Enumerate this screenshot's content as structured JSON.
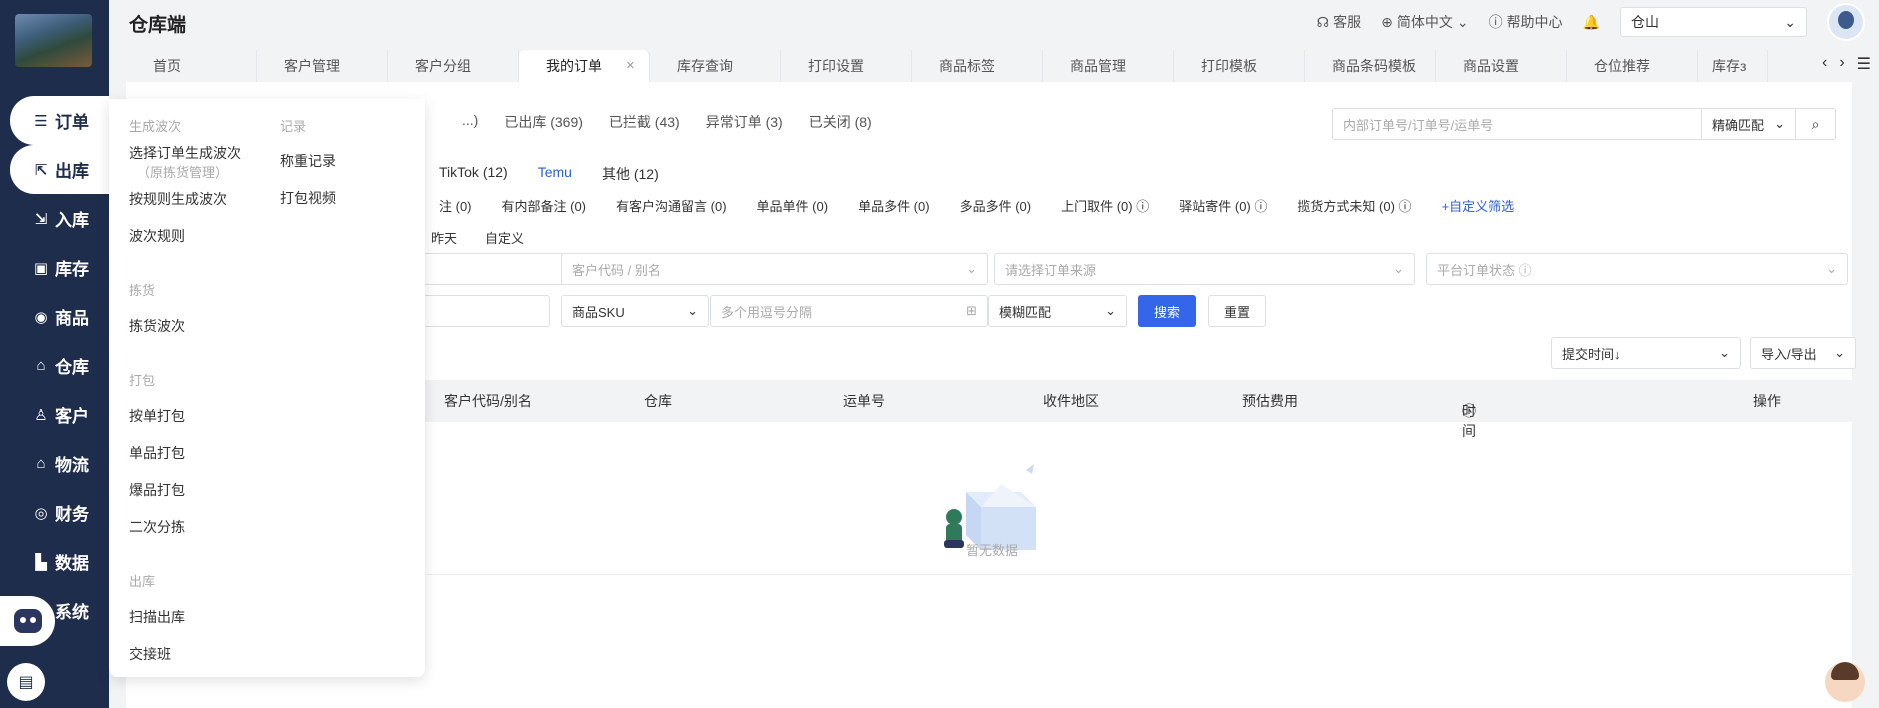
{
  "app": {
    "title": "仓库端"
  },
  "topbar": {
    "service": "客服",
    "language": "简体中文",
    "help": "帮助中心",
    "warehouse": "仓山"
  },
  "sidebar": {
    "items": [
      {
        "label": "订单",
        "icon": "list-icon"
      },
      {
        "label": "出库",
        "icon": "export-icon"
      },
      {
        "label": "入库",
        "icon": "import-icon"
      },
      {
        "label": "库存",
        "icon": "box-icon"
      },
      {
        "label": "商品",
        "icon": "bag-icon"
      },
      {
        "label": "仓库",
        "icon": "house-icon"
      },
      {
        "label": "客户",
        "icon": "user-icon"
      },
      {
        "label": "物流",
        "icon": "truck-icon"
      },
      {
        "label": "财务",
        "icon": "money-icon"
      },
      {
        "label": "数据",
        "icon": "chart-icon"
      },
      {
        "label": "系统",
        "icon": "robot-icon"
      }
    ]
  },
  "tabs": [
    "首页",
    "客户管理",
    "客户分组",
    "我的订单",
    "库存查询",
    "打印设置",
    "商品标签",
    "商品管理",
    "打印模板",
    "商品条码模板",
    "商品设置",
    "仓位推荐",
    "库存з"
  ],
  "status_tabs": [
    "...)",
    "已出库 (369)",
    "已拦截 (43)",
    "异常订单 (3)",
    "已关闭 (8)"
  ],
  "search": {
    "placeholder": "内部订单号/订单号/运单号",
    "mode": "精确匹配"
  },
  "platforms": [
    "TikTok (12)",
    "Temu",
    "其他 (12)"
  ],
  "filters": [
    "注 (0)",
    "有内部备注 (0)",
    "有客户沟通留言 (0)",
    "单品单件 (0)",
    "单品多件 (0)",
    "多品多件 (0)",
    "上门取件 (0)",
    "驿站寄件 (0)",
    "揽货方式未知 (0)",
    "+自定义筛选"
  ],
  "dates": [
    "昨天",
    "自定义"
  ],
  "form": {
    "customer_placeholder": "客户代码 / 别名",
    "source_placeholder": "请选择订单来源",
    "platform_status_placeholder": "平台订单状态",
    "sku_type": "商品SKU",
    "sku_placeholder": "多个用逗号分隔",
    "match_mode": "模糊匹配",
    "search_btn": "搜索",
    "reset_btn": "重置",
    "sort": "提交时间↓",
    "import_export": "导入/导出"
  },
  "table": {
    "headers": [
      "客户代码/别名",
      "仓库",
      "运单号",
      "收件地区",
      "预估费用",
      "时间",
      "操作"
    ],
    "empty": "暂无数据"
  },
  "menu": {
    "groups": [
      {
        "title": "生成波次",
        "items": [
          "选择订单生成波次",
          "按规则生成波次",
          "波次规则"
        ],
        "sub": "（原拣货管理）"
      },
      {
        "title": "拣货",
        "items": [
          "拣货波次"
        ]
      },
      {
        "title": "打包",
        "items": [
          "按单打包",
          "单品打包",
          "爆品打包",
          "二次分拣"
        ]
      },
      {
        "title": "出库",
        "items": [
          "扫描出库",
          "交接班"
        ]
      },
      {
        "title": "记录",
        "items": [
          "称重记录",
          "打包视频"
        ]
      }
    ]
  }
}
